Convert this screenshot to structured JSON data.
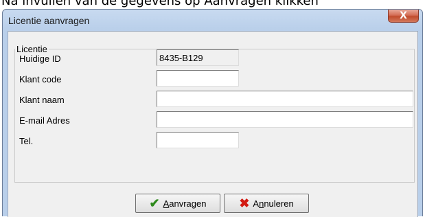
{
  "caption": "Na invullen van de gegevens op Aanvragen klikken",
  "window": {
    "title": "Licentie aanvragen",
    "close_glyph": "X"
  },
  "group": {
    "legend": "Licentie"
  },
  "form": {
    "current_id_label": "Huidige ID",
    "current_id_value": "8435-B129",
    "client_code_label": "Klant code",
    "client_code_value": "",
    "client_name_label": "Klant naam",
    "client_name_value": "",
    "email_label": "E-mail Adres",
    "email_value": "",
    "tel_label": "Tel.",
    "tel_value": ""
  },
  "buttons": {
    "request_label_underlined": "A",
    "request_label_rest": "anvragen",
    "request_icon": "check-icon",
    "cancel_label_pre": "A",
    "cancel_label_underlined": "n",
    "cancel_label_rest": "nuleren",
    "cancel_icon": "x-icon"
  },
  "colors": {
    "titlebar": "#b9cfea",
    "close_button": "#c14b2c",
    "client_area": "#f0f0f0",
    "check_icon": "#2f8a1d",
    "cancel_icon": "#d21a12"
  }
}
